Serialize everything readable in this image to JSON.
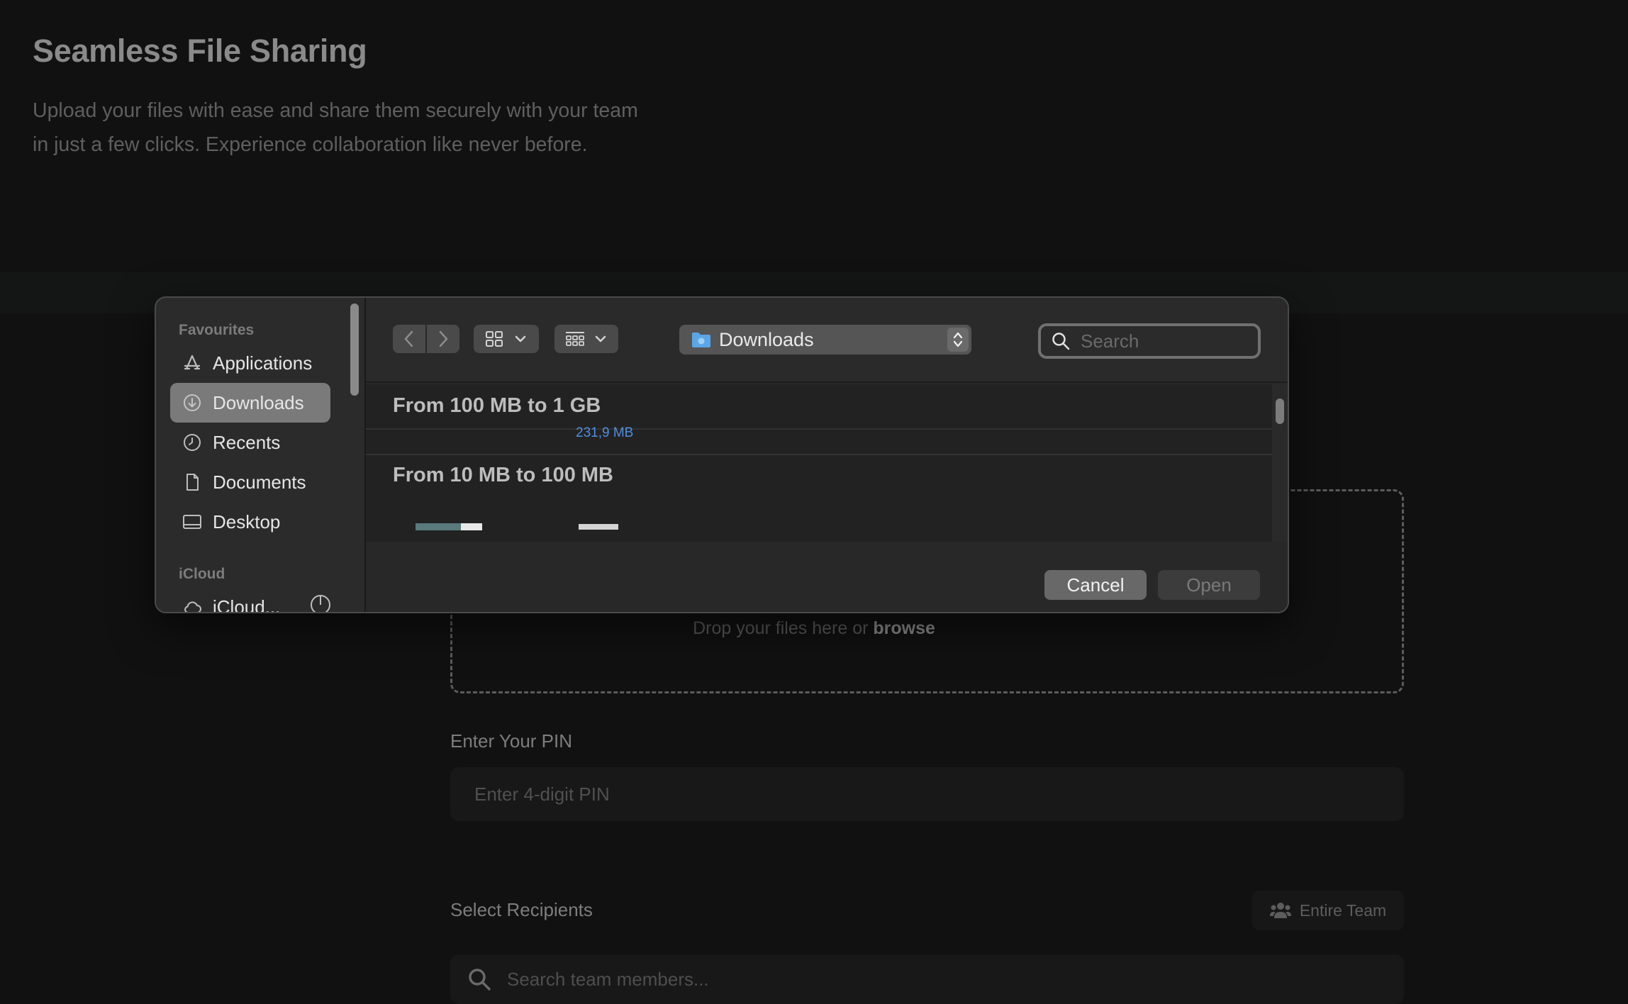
{
  "page": {
    "title": "Seamless File Sharing",
    "description": "Upload your files with ease and share them securely with your team in just a few clicks. Experience collaboration like never before.",
    "dropzone": {
      "text": "Drop your files here or ",
      "browse_label": "browse"
    },
    "pin": {
      "label": "Enter Your PIN",
      "placeholder": "Enter 4-digit PIN"
    },
    "recipients": {
      "label": "Select Recipients",
      "entire_team_label": "Entire Team",
      "search_placeholder": "Search team members..."
    }
  },
  "dialog": {
    "sidebar": {
      "favourites_heading": "Favourites",
      "items": [
        {
          "label": "Applications",
          "icon": "applications-icon"
        },
        {
          "label": "Downloads",
          "icon": "downloads-icon",
          "selected": true
        },
        {
          "label": "Recents",
          "icon": "clock-icon"
        },
        {
          "label": "Documents",
          "icon": "document-icon"
        },
        {
          "label": "Desktop",
          "icon": "desktop-icon"
        }
      ],
      "icloud_heading": "iCloud",
      "icloud_item": {
        "label": "iCloud...",
        "icon": "cloud-icon"
      }
    },
    "toolbar": {
      "location": "Downloads",
      "search_placeholder": "Search"
    },
    "groups": [
      {
        "title": "From 100 MB to 1 GB",
        "file_size": "231,9 MB"
      },
      {
        "title": "From 10 MB to 100 MB"
      }
    ],
    "buttons": {
      "cancel": "Cancel",
      "open": "Open"
    }
  },
  "colors": {
    "background": "#111112",
    "dialog": "#262626",
    "selection": "#7a7a7a",
    "size_label": "#4f8ee0"
  }
}
